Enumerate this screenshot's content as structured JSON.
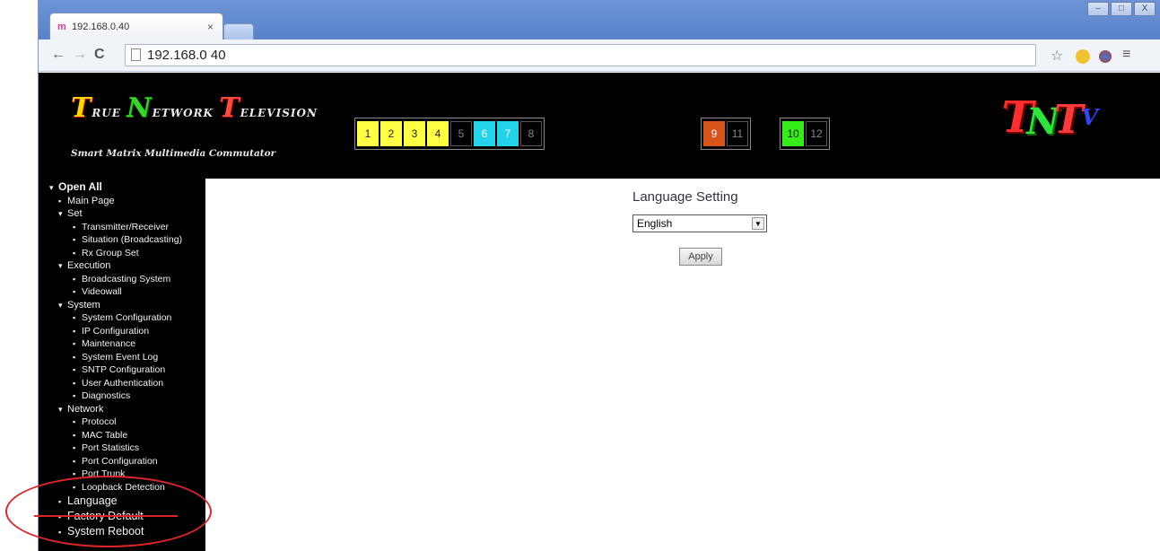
{
  "browser": {
    "tab_title": "192.168.0.40",
    "tab_favicon": "m",
    "tab_close": "×",
    "url": "192.168.0 40",
    "back_icon": "←",
    "forward_icon": "→",
    "reload_icon": "C",
    "window_buttons": [
      "–",
      "□",
      "X"
    ],
    "star_icon": "☆",
    "menu_icon": "≡"
  },
  "banner": {
    "brand_T": "T",
    "brand_rue": "RUE",
    "brand_N": "N",
    "brand_etwork": "ETWORK",
    "brand_T2": "T",
    "brand_elevision": "ELEVISION",
    "subtitle": "Smart Matrix Multimedia Commutator",
    "channels_a": [
      {
        "label": "1",
        "color": "yellow"
      },
      {
        "label": "2",
        "color": "yellow"
      },
      {
        "label": "3",
        "color": "yellow"
      },
      {
        "label": "4",
        "color": "yellow"
      },
      {
        "label": "5",
        "color": "dark"
      },
      {
        "label": "6",
        "color": "cyan"
      },
      {
        "label": "7",
        "color": "cyan"
      },
      {
        "label": "8",
        "color": "dark"
      }
    ],
    "channels_b": [
      {
        "label": "9",
        "color": "orange"
      },
      {
        "label": "11",
        "color": "dark"
      }
    ],
    "channels_c": [
      {
        "label": "10",
        "color": "lime"
      },
      {
        "label": "12",
        "color": "dark"
      }
    ],
    "logo": {
      "t": "T",
      "n": "N",
      "t2": "T",
      "v": "V"
    }
  },
  "sidebar": {
    "open_all": "Open All",
    "items": [
      {
        "label": "Main Page",
        "level": 1,
        "marker": "▪"
      },
      {
        "label": "Set",
        "level": 1,
        "marker": "▾"
      },
      {
        "label": "Transmitter/Receiver",
        "level": 2,
        "marker": "▪"
      },
      {
        "label": "Situation (Broadcasting)",
        "level": 2,
        "marker": "▪"
      },
      {
        "label": "Rx Group Set",
        "level": 2,
        "marker": "▪"
      },
      {
        "label": "Execution",
        "level": 1,
        "marker": "▾"
      },
      {
        "label": "Broadcasting System",
        "level": 2,
        "marker": "▪"
      },
      {
        "label": "Videowall",
        "level": 2,
        "marker": "▪"
      },
      {
        "label": "System",
        "level": 1,
        "marker": "▾"
      },
      {
        "label": "System Configuration",
        "level": 2,
        "marker": "▪"
      },
      {
        "label": "IP Configuration",
        "level": 2,
        "marker": "▪"
      },
      {
        "label": "Maintenance",
        "level": 2,
        "marker": "▪"
      },
      {
        "label": "System Event Log",
        "level": 2,
        "marker": "▪"
      },
      {
        "label": "SNTP Configuration",
        "level": 2,
        "marker": "▪"
      },
      {
        "label": "User Authentication",
        "level": 2,
        "marker": "▪"
      },
      {
        "label": "Diagnostics",
        "level": 2,
        "marker": "▪"
      },
      {
        "label": "Network",
        "level": 1,
        "marker": "▾"
      },
      {
        "label": "Protocol",
        "level": 2,
        "marker": "▪"
      },
      {
        "label": "MAC Table",
        "level": 2,
        "marker": "▪"
      },
      {
        "label": "Port Statistics",
        "level": 2,
        "marker": "▪"
      },
      {
        "label": "Port Configuration",
        "level": 2,
        "marker": "▪"
      },
      {
        "label": "Port Trunk",
        "level": 2,
        "marker": "▪"
      },
      {
        "label": "Loopback Detection",
        "level": 2,
        "marker": "▪"
      },
      {
        "label": "Language",
        "level": 1,
        "marker": "▪",
        "big": true
      },
      {
        "label": "Factory Default",
        "level": 1,
        "marker": "▪",
        "big": true
      },
      {
        "label": "System Reboot",
        "level": 1,
        "marker": "▪",
        "big": true
      }
    ]
  },
  "main": {
    "title": "Language Setting",
    "select_value": "English",
    "apply_label": "Apply"
  },
  "colors": {
    "annotation": "#e0252a",
    "banner_bg": "#000000"
  }
}
